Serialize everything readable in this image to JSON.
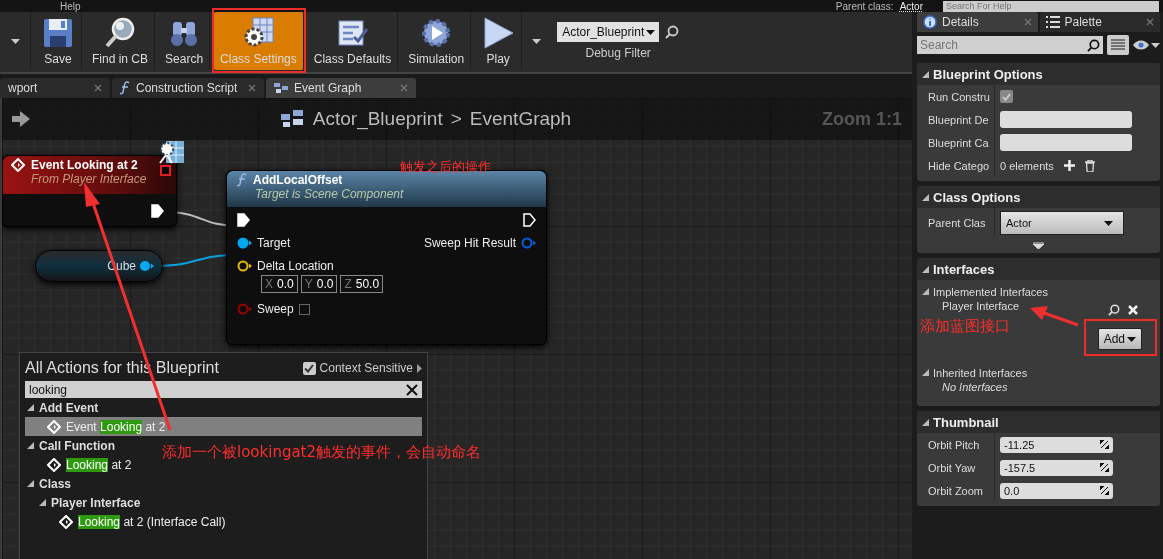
{
  "menu_bar": {
    "items": [
      {
        "label": "Help"
      }
    ],
    "parent_class": {
      "label": "Parent class:",
      "value": "Actor"
    },
    "help_search": {
      "placeholder": "Search For Help"
    }
  },
  "toolbar": {
    "buttons": [
      {
        "kind": "save",
        "label": "Save",
        "selected": false
      },
      {
        "kind": "find",
        "label": "Find in CB",
        "selected": false
      },
      {
        "kind": "search",
        "label": "Search",
        "selected": false
      },
      {
        "kind": "class_settings",
        "label": "Class Settings",
        "selected": true
      },
      {
        "kind": "class_defaults",
        "label": "Class Defaults",
        "selected": false
      },
      {
        "kind": "simulation",
        "label": "Simulation",
        "selected": false
      },
      {
        "kind": "play",
        "label": "Play",
        "selected": false
      }
    ],
    "debug_filter": {
      "value": "Actor_Blueprint",
      "label": "Debug Filter"
    }
  },
  "editor_tabs": [
    {
      "kind": "viewport",
      "label": "wport",
      "selected": false
    },
    {
      "kind": "function",
      "label": "Construction Script",
      "selected": false
    },
    {
      "kind": "graph",
      "label": "Event Graph",
      "selected": true
    }
  ],
  "graph": {
    "breadcrumb": {
      "blueprint": "Actor_Blueprint",
      "separator": ">",
      "graph": "EventGraph"
    },
    "zoom": "Zoom 1:1",
    "event_node": {
      "title": "Event Looking at 2",
      "subtitle": "From Player Interface"
    },
    "variable_node": {
      "name": "Cube"
    },
    "function_node": {
      "title": "AddLocalOffset",
      "subtitle": "Target is Scene Component",
      "rows": [
        {
          "left": {
            "kind": "exec",
            "connected": true
          },
          "right": {
            "kind": "exec",
            "connected": false
          }
        },
        {
          "left": {
            "kind": "data",
            "label": "Target",
            "color": "#00a8f0",
            "connected": true
          },
          "right": {
            "kind": "data",
            "label": "Sweep Hit Result",
            "color": "#0a5cd8",
            "connected": false
          }
        },
        {
          "left": {
            "kind": "vector",
            "label": "Delta Location",
            "color": "#e6b800",
            "connected": false,
            "fields": [
              {
                "axis": "X",
                "value": "0.0"
              },
              {
                "axis": "Y",
                "value": "0.0"
              },
              {
                "axis": "Z",
                "value": "50.0"
              }
            ]
          }
        },
        {
          "left": {
            "kind": "bool",
            "label": "Sweep",
            "color": "#9a0000",
            "connected": false,
            "checked": false
          }
        }
      ]
    },
    "action_menu": {
      "title": "All Actions for this Blueprint",
      "context_sensitive": {
        "label": "Context Sensitive",
        "checked": true
      },
      "search": {
        "value": "looking"
      },
      "tree": [
        {
          "kind": "category",
          "label": "Add Event",
          "expanded": true,
          "children": [
            {
              "kind": "action",
              "before": "Event ",
              "match": "Looking",
              "after": " at 2",
              "selected": true
            }
          ]
        },
        {
          "kind": "category",
          "label": "Call Function",
          "expanded": true,
          "children": [
            {
              "kind": "action",
              "match": "Looking",
              "after": " at 2",
              "selected": false
            }
          ]
        },
        {
          "kind": "category",
          "label": "Class",
          "expanded": true,
          "children": [
            {
              "kind": "category",
              "label": "Player Interface",
              "expanded": true,
              "children": [
                {
                  "kind": "action",
                  "match": "Looking",
                  "after": " at 2 (Interface Call)",
                  "selected": false
                }
              ]
            }
          ]
        }
      ]
    }
  },
  "details_panel": {
    "tabs": [
      {
        "kind": "details",
        "label": "Details",
        "selected": true
      },
      {
        "kind": "palette",
        "label": "Palette",
        "selected": false
      }
    ],
    "search": {
      "placeholder": "Search"
    },
    "sections": [
      {
        "kind": "properties",
        "title": "Blueprint Options",
        "has_advanced": false,
        "rows": [
          {
            "kind": "checkbox",
            "label": "Run Constru",
            "checked": true
          },
          {
            "kind": "text",
            "label": "Blueprint De"
          },
          {
            "kind": "text",
            "label": "Blueprint Ca"
          },
          {
            "kind": "array",
            "label": "Hide Catego",
            "value": "0 elements"
          }
        ]
      },
      {
        "kind": "properties",
        "title": "Class Options",
        "has_advanced": true,
        "rows": [
          {
            "kind": "dropdown",
            "label": "Parent Clas",
            "value": "Actor"
          }
        ]
      },
      {
        "kind": "interfaces",
        "title": "Interfaces",
        "has_advanced": false,
        "implemented": {
          "label": "Implemented Interfaces",
          "items": [
            {
              "label": "Player Interface"
            }
          ],
          "add_button": "Add"
        },
        "inherited": {
          "label": "Inherited Interfaces",
          "empty": "No Interfaces"
        }
      },
      {
        "kind": "properties",
        "title": "Thumbnail",
        "has_advanced": false,
        "rows": [
          {
            "kind": "number",
            "label": "Orbit Pitch",
            "value": "-11.25"
          },
          {
            "kind": "number",
            "label": "Orbit Yaw",
            "value": "-157.5"
          },
          {
            "kind": "number",
            "label": "Orbit Zoom",
            "value": "0.0"
          }
        ]
      }
    ]
  },
  "annotations": [
    {
      "kind": "note",
      "text": "触发之后的操作"
    },
    {
      "kind": "note",
      "text": "添加一个被lookingat2触发的事件，会自动命名"
    },
    {
      "kind": "note",
      "text": "添加蓝图接口"
    }
  ]
}
